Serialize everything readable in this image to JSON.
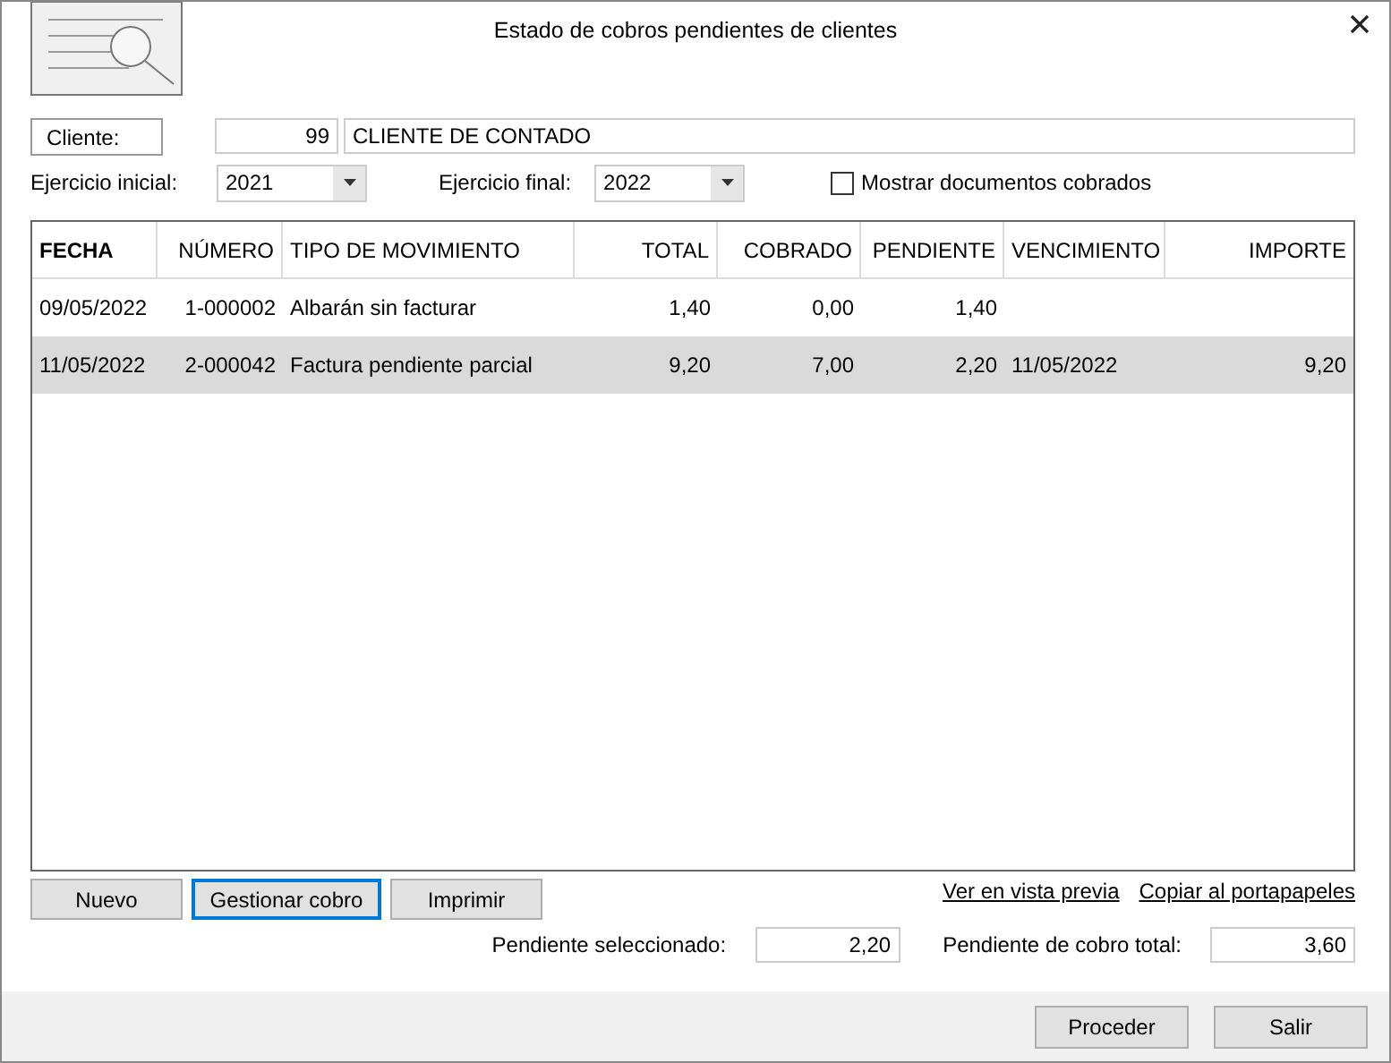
{
  "window": {
    "title": "Estado de cobros pendientes de clientes"
  },
  "cliente": {
    "label": "Cliente:",
    "code": "99",
    "name": "CLIENTE DE CONTADO"
  },
  "ejercicio_inicial": {
    "label": "Ejercicio inicial:",
    "value": "2021"
  },
  "ejercicio_final": {
    "label": "Ejercicio final:",
    "value": "2022"
  },
  "mostrar_cobrados": {
    "label": "Mostrar documentos cobrados",
    "checked": false
  },
  "table": {
    "columns": [
      {
        "label": "FECHA",
        "bold": true
      },
      {
        "label": "NÚMERO",
        "bold": false
      },
      {
        "label": "TIPO DE MOVIMIENTO",
        "bold": false
      },
      {
        "label": "TOTAL",
        "bold": false
      },
      {
        "label": "COBRADO",
        "bold": false
      },
      {
        "label": "PENDIENTE",
        "bold": false
      },
      {
        "label": "VENCIMIENTO",
        "bold": false
      },
      {
        "label": "IMPORTE",
        "bold": false
      }
    ],
    "rows": [
      {
        "selected": false,
        "cells": [
          "09/05/2022",
          "1-000002",
          "Albarán sin facturar",
          "1,40",
          "0,00",
          "1,40",
          "",
          ""
        ]
      },
      {
        "selected": true,
        "cells": [
          "11/05/2022",
          "2-000042",
          "Factura pendiente parcial",
          "9,20",
          "7,00",
          "2,20",
          "11/05/2022",
          "9,20"
        ]
      }
    ]
  },
  "actions": [
    {
      "label": "Nuevo",
      "focused": false
    },
    {
      "label": "Gestionar cobro",
      "focused": true
    },
    {
      "label": "Imprimir",
      "focused": false
    }
  ],
  "links": [
    "Ver en vista previa",
    "Copiar al portapapeles"
  ],
  "totals": [
    {
      "label": "Pendiente seleccionado:",
      "value": "2,20"
    },
    {
      "label": "Pendiente de cobro total:",
      "value": "3,60"
    }
  ],
  "footer_buttons": [
    "Proceder",
    "Salir"
  ]
}
